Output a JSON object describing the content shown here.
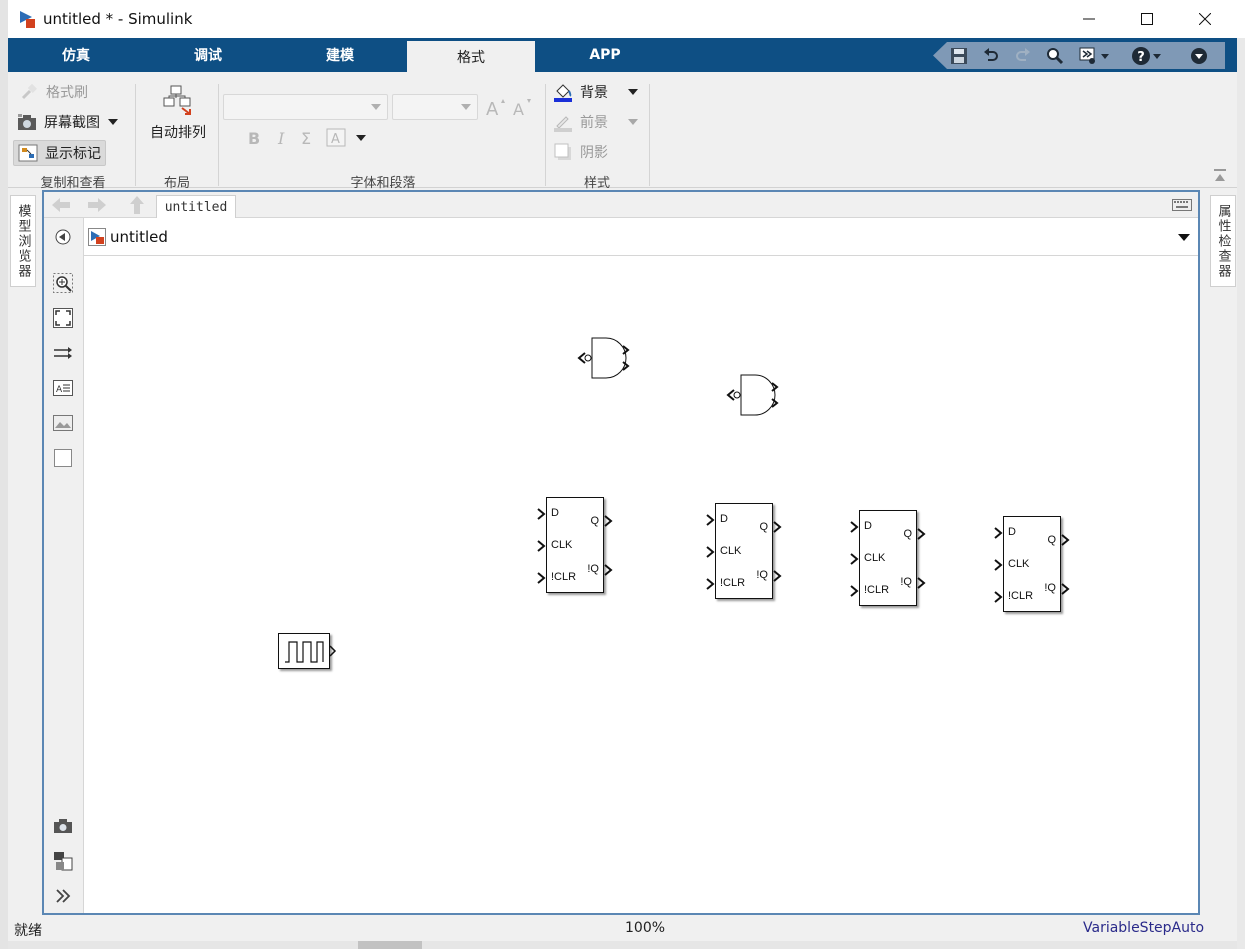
{
  "window": {
    "title": "untitled * - Simulink"
  },
  "tabs": [
    {
      "label": "仿真",
      "active": false
    },
    {
      "label": "调试",
      "active": false
    },
    {
      "label": "建模",
      "active": false
    },
    {
      "label": "格式",
      "active": true
    },
    {
      "label": "APP",
      "active": false
    }
  ],
  "ribbon": {
    "copy_view": {
      "format_painter": "格式刷",
      "screenshot": "屏幕截图",
      "show_markup": "显示标记",
      "label": "复制和查看"
    },
    "layout": {
      "auto_arrange": "自动排列",
      "label": "布局"
    },
    "font": {
      "label": "字体和段落"
    },
    "style": {
      "background": "背景",
      "foreground": "前景",
      "shadow": "阴影",
      "label": "样式"
    }
  },
  "side_panels": {
    "left": "模型浏览器",
    "right": "属性检查器"
  },
  "editor": {
    "crumb_tab": "untitled",
    "address": "untitled"
  },
  "blocks": {
    "dff_ports": {
      "d": "D",
      "clk": "CLK",
      "clr": "!CLR",
      "q": "Q",
      "nq": "!Q"
    }
  },
  "status": {
    "left": "就绪",
    "zoom": "100%",
    "solver": "VariableStepAuto"
  },
  "colors": {
    "tabbar": "#0e4f84",
    "editor_border": "#5b87b4",
    "solver_text": "#2a2a8a"
  }
}
